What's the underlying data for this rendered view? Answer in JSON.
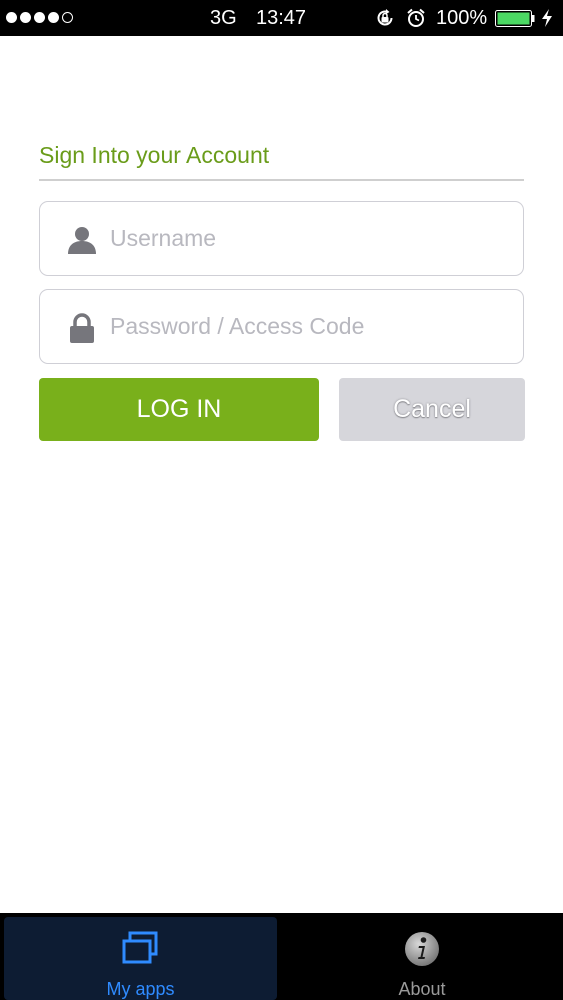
{
  "status_bar": {
    "network": "3G",
    "time": "13:47",
    "battery_percent": "100%",
    "signal_strength": {
      "filled": 4,
      "total": 5
    },
    "icons": [
      "rotation-lock-icon",
      "alarm-icon",
      "battery-icon",
      "charging-icon"
    ]
  },
  "login": {
    "title": "Sign Into your Account",
    "username": {
      "value": "",
      "placeholder": "Username",
      "icon": "user-icon"
    },
    "password": {
      "value": "",
      "placeholder": "Password / Access Code",
      "icon": "lock-icon"
    },
    "login_label": "LOG IN",
    "cancel_label": "Cancel"
  },
  "tab_bar": {
    "tabs": [
      {
        "label": "My apps",
        "icon": "stacked-windows-icon",
        "active": true
      },
      {
        "label": "About",
        "icon": "info-icon",
        "active": false
      }
    ]
  },
  "colors": {
    "accent_green": "#79b01b",
    "title_green": "#6a9c1a",
    "active_tab_blue": "#2f8bff",
    "cancel_gray": "#d6d6db"
  }
}
